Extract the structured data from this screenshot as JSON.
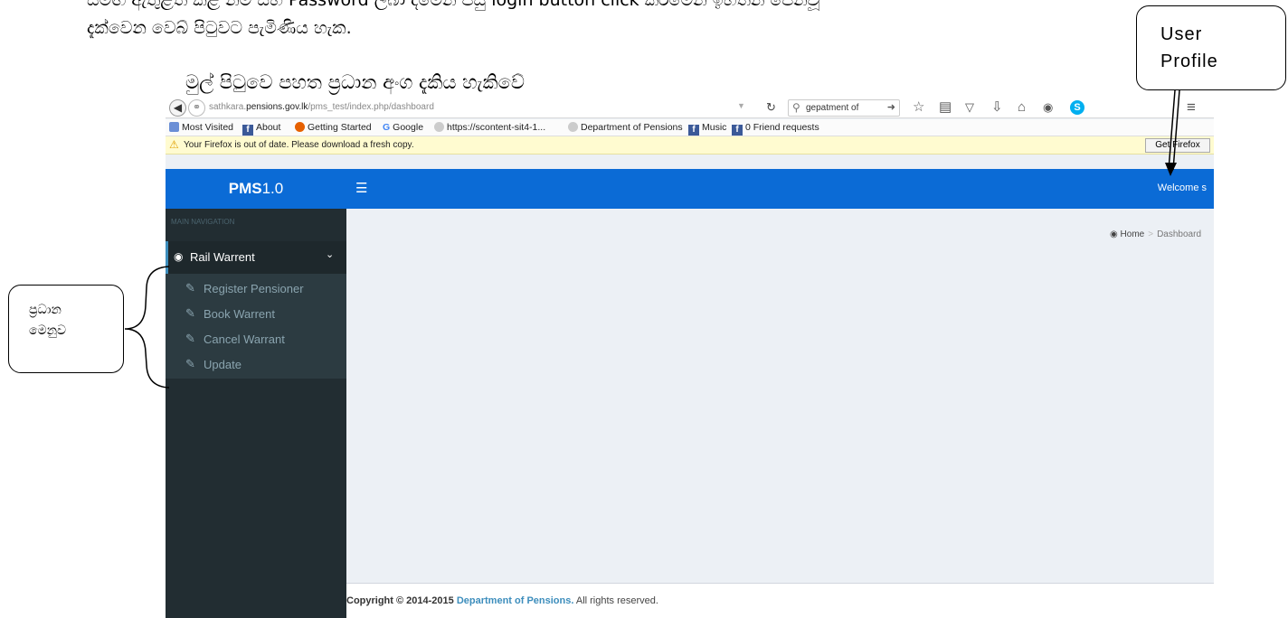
{
  "document": {
    "line0": "සමඟ ඇතුළත් කළ නම සහ Password ලබා දීමෙන් පසු login button click කිරීමෙන් ඉහතින් පෙන්වූ",
    "line1": "දැක්වෙන වෙබ් පිටුවට පැමිණිය හැක.",
    "heading": "මුල් පිටුවෙ පහත ප්‍රධාන අංග දැකිය හැකිවේ"
  },
  "callouts": {
    "user_profile": "User\nProfile",
    "main_menu": "ප්‍රධාන\nමෙනුව"
  },
  "browser": {
    "url_prefix": "sathkara.",
    "url_domain": "pensions.gov.lk",
    "url_path": "/pms_test/index.php/dashboard",
    "search_value": "gepatment of",
    "bookmarks": [
      {
        "label": "Most Visited",
        "icon": "most-visited-icon"
      },
      {
        "label": "About",
        "icon": "facebook-icon"
      },
      {
        "label": "Getting Started",
        "icon": "firefox-icon"
      },
      {
        "label": "Google",
        "icon": "google-icon"
      },
      {
        "label": "https://scontent-sit4-1...",
        "icon": "globe-icon"
      },
      {
        "label": "Department of Pensions",
        "icon": "globe-icon"
      },
      {
        "label": "Music",
        "icon": "facebook-icon"
      },
      {
        "label": "0 Friend requests",
        "icon": "facebook-icon"
      }
    ],
    "notice": "Your Firefox is out of date. Please download a fresh copy.",
    "notice_button": "Get Firefox"
  },
  "app": {
    "logo_bold": "PMS",
    "logo_version": "1.0",
    "welcome": "Welcome s",
    "nav_header": "MAIN NAVIGATION",
    "menu_title": "Rail Warrent",
    "submenu": [
      "Register Pensioner",
      "Book Warrent",
      "Cancel Warrant",
      "Update"
    ],
    "breadcrumb": {
      "home": "Home",
      "current": "Dashboard"
    },
    "footer": {
      "prefix": "Copyright © 2014-2015",
      "org": "Department of Pensions.",
      "suffix": "All rights reserved."
    }
  },
  "colors": {
    "topbar": "#0b6bd6",
    "sidebar": "#222d32",
    "content": "#ecf0f5",
    "notice": "#fffbd0",
    "link": "#3c8dbc"
  }
}
